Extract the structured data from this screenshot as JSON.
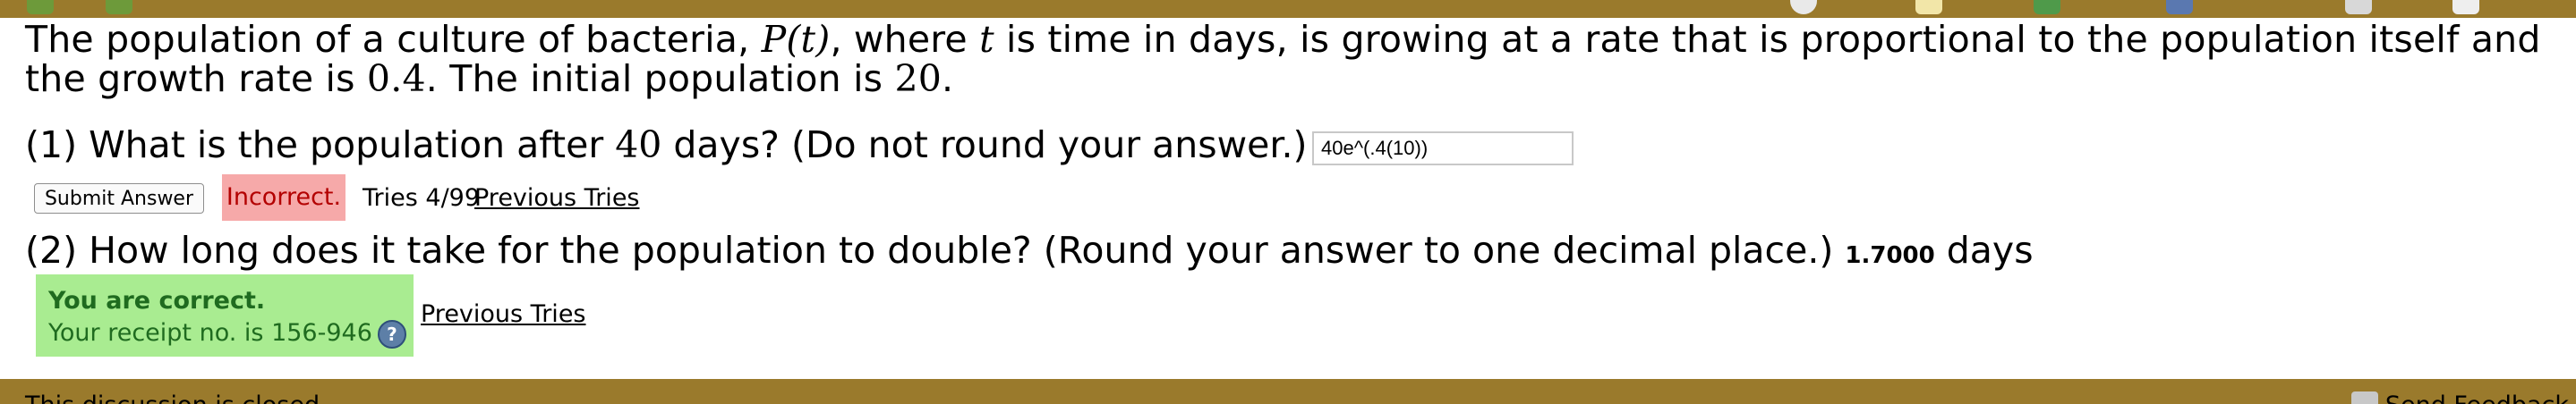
{
  "problem": {
    "text_a": "The population of a culture of bacteria, ",
    "fn": "P(t)",
    "text_b": ", where ",
    "var_t": "t",
    "text_c": " is time in days, is growing at a rate that is proportional to the population itself and the growth rate is ",
    "rate": "0.4",
    "text_d": ". The initial population is ",
    "initial": "20",
    "text_e": "."
  },
  "part1": {
    "q_a": "(1) What is the population after ",
    "days": "40",
    "q_b": " days? (Do not round your answer.)",
    "input_value": "40e^(.4(10))",
    "submit_label": "Submit Answer",
    "status": "Incorrect.",
    "tries": "Tries 4/99",
    "previous_tries": "Previous Tries"
  },
  "part2": {
    "question": "(2) How long does it take for the population to double? (Round your answer to one decimal place.) ",
    "answer": "1.7000",
    "unit": "days",
    "correct_title": "You are correct.",
    "receipt": "Your receipt no. is 156-946",
    "help_glyph": "?",
    "previous_tries": "Previous Tries"
  },
  "footer": {
    "closed": "This discussion is closed.",
    "feedback": "Send Feedback"
  },
  "colors": {
    "bar": "#9a7a2c",
    "incorrect_bg": "#f6a9a9",
    "correct_bg": "#a9ec91"
  },
  "icons": [
    "back-arrow-icon",
    "forward-arrow-icon",
    "help-icon",
    "feedback-icon"
  ]
}
